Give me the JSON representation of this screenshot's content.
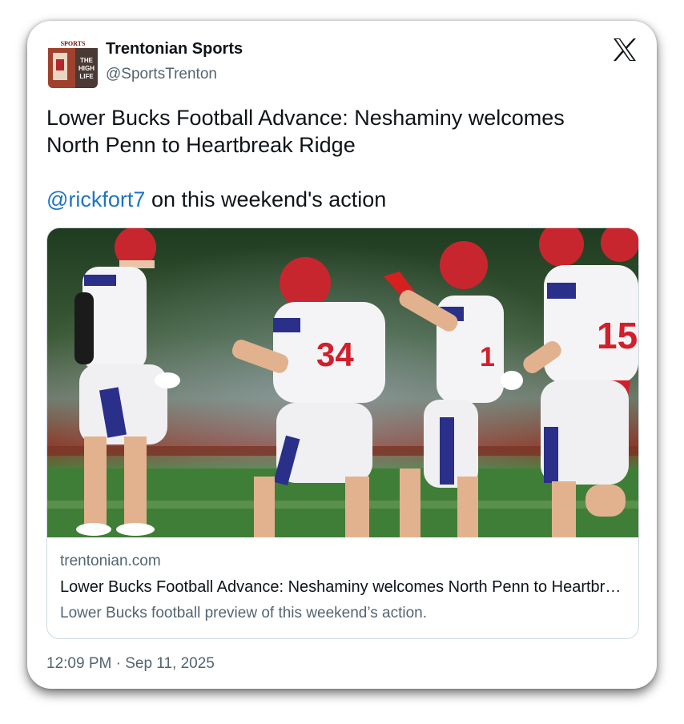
{
  "author": {
    "display_name": "Trentonian Sports",
    "handle": "@SportsTrenton",
    "avatar_masthead": "SPORTS",
    "avatar_headline_1": "THE",
    "avatar_headline_2": "HIGH",
    "avatar_headline_3": "LIFE"
  },
  "platform_icon": "x-logo-icon",
  "tweet": {
    "headline_line1": "Lower Bucks Football Advance: Neshaminy welcomes",
    "headline_line2": "North Penn to Heartbreak Ridge",
    "mention": "@rickfort7",
    "mention_suffix": " on this weekend's action"
  },
  "link_card": {
    "domain": "trentonian.com",
    "title": "Lower Bucks Football Advance: Neshaminy welcomes North Penn to Heartbreak Ridge",
    "description": "Lower Bucks football preview of this weekend’s action.",
    "jersey_numbers": [
      "34",
      "15",
      "1"
    ]
  },
  "timestamp": "12:09 PM · Sep 11, 2025",
  "colors": {
    "link_blue": "#1d74c6",
    "text_primary": "#0f1419",
    "text_secondary": "#536471",
    "jersey_red": "#d21f2b",
    "jersey_navy": "#2a2f8a"
  }
}
